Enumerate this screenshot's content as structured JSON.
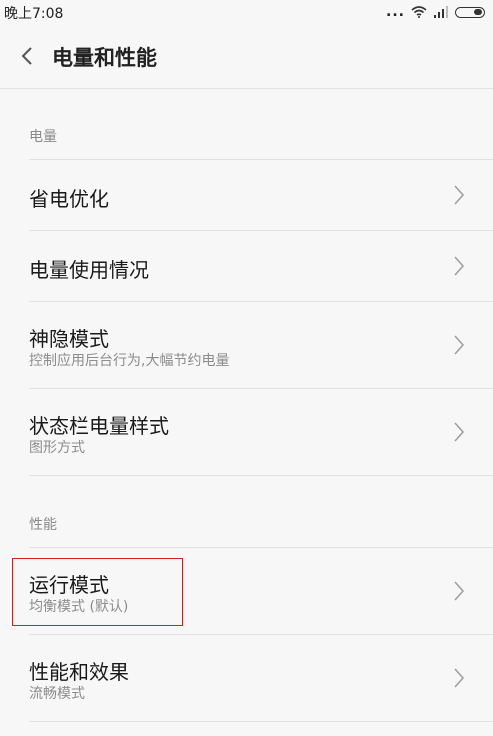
{
  "status_bar": {
    "time": "晚上7:08",
    "icons": [
      "more-dots-icon",
      "wifi-icon",
      "signal-icon",
      "battery-icon"
    ],
    "dots": "..."
  },
  "header": {
    "title": "电量和性能",
    "back_icon": "chevron-left-icon"
  },
  "sections": [
    {
      "label": "电量",
      "items": [
        {
          "title": "省电优化",
          "subtitle": ""
        },
        {
          "title": "电量使用情况",
          "subtitle": ""
        },
        {
          "title": "神隐模式",
          "subtitle": "控制应用后台行为,大幅节约电量"
        },
        {
          "title": "状态栏电量样式",
          "subtitle": "图形方式"
        }
      ]
    },
    {
      "label": "性能",
      "items": [
        {
          "title": "运行模式",
          "subtitle": "均衡模式 (默认)"
        },
        {
          "title": "性能和效果",
          "subtitle": "流畅模式"
        }
      ]
    }
  ],
  "colors": {
    "background": "#f7f7f7",
    "divider": "#e2e2e2",
    "highlight_border": "#cc2222",
    "subtitle": "#8c8c8c"
  }
}
